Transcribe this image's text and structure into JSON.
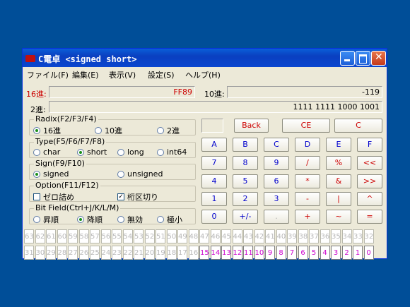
{
  "window": {
    "title": "C電卓 <signed short>"
  },
  "menu": [
    "ファイル(F)",
    "編集(E)",
    "表示(V)",
    "設定(S)",
    "ヘルプ(H)"
  ],
  "display": {
    "hex_label": "16進:",
    "hex_value": "FF89",
    "dec_label": "10進:",
    "dec_value": "-119",
    "bin_label": "2進:",
    "bin_value": "1111 1111 1000 1001"
  },
  "radix": {
    "legend": "Radix(F2/F3/F4)",
    "options": [
      "16進",
      "10進",
      "2進"
    ],
    "selected": "16進"
  },
  "type": {
    "legend": "Type(F5/F6/F7/F8)",
    "options": [
      "char",
      "short",
      "long",
      "int64"
    ],
    "selected": "short"
  },
  "sign": {
    "legend": "Sign(F9/F10)",
    "options": [
      "signed",
      "unsigned"
    ],
    "selected": "signed"
  },
  "option": {
    "legend": "Option(F11/F12)",
    "zero_fill": "ゼロ詰め",
    "digit_sep": "桁区切り",
    "zero_fill_checked": false,
    "digit_sep_checked": true
  },
  "bitfield": {
    "legend": "Bit Field(Ctrl+J/K/L/M)",
    "options": [
      "昇順",
      "降順",
      "無効",
      "極小"
    ],
    "selected": "降順"
  },
  "keys": {
    "back": "Back",
    "ce": "CE",
    "c": "C",
    "rows": [
      [
        "A",
        "B",
        "C",
        "D",
        "E",
        "F"
      ],
      [
        "7",
        "8",
        "9",
        "/",
        "%",
        "<<"
      ],
      [
        "4",
        "5",
        "6",
        "*",
        "&",
        ">>"
      ],
      [
        "1",
        "2",
        "3",
        "-",
        "|",
        "^"
      ],
      [
        "0",
        "+/-",
        ".",
        "+",
        "~",
        "="
      ]
    ]
  },
  "bits": {
    "upper": [
      "63",
      "62",
      "61",
      "60",
      "59",
      "58",
      "57",
      "56",
      "55",
      "54",
      "53",
      "52",
      "51",
      "50",
      "49",
      "48",
      "47",
      "46",
      "45",
      "44",
      "43",
      "42",
      "41",
      "40",
      "39",
      "38",
      "37",
      "36",
      "35",
      "34",
      "33",
      "32"
    ],
    "lower": [
      "31",
      "30",
      "29",
      "28",
      "27",
      "26",
      "25",
      "24",
      "23",
      "22",
      "21",
      "20",
      "19",
      "18",
      "17",
      "16",
      "15",
      "14",
      "13",
      "12",
      "11",
      "10",
      "9",
      "8",
      "7",
      "6",
      "5",
      "4",
      "3",
      "2",
      "1",
      "0"
    ]
  }
}
